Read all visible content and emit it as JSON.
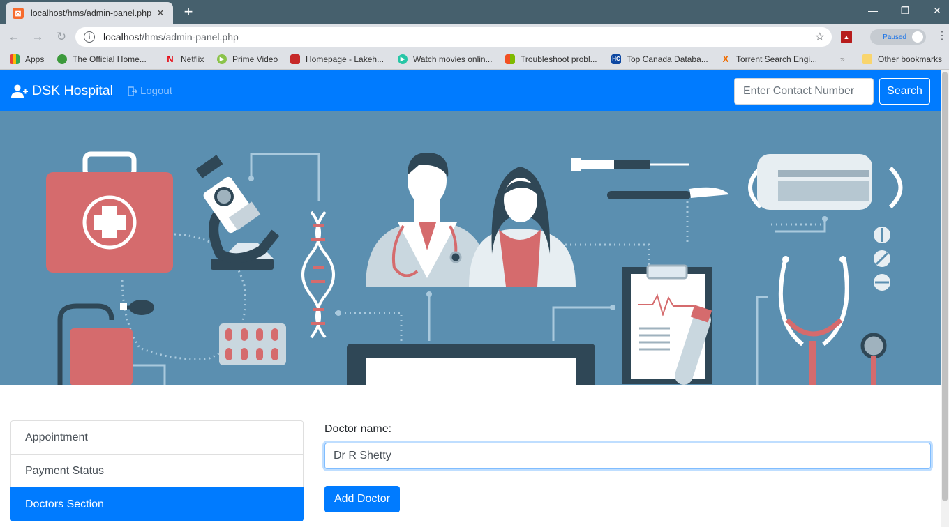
{
  "browser": {
    "tab_title": "localhost/hms/admin-panel.php",
    "url_host": "localhost",
    "url_path": "/hms/admin-panel.php",
    "profile_name": "Paused",
    "bookmarks": [
      {
        "label": "Apps",
        "icon": "apps-grid-icon",
        "color": "#4285f4"
      },
      {
        "label": "The Official Home...",
        "icon": "globe-icon",
        "color": "#3c9a3c"
      },
      {
        "label": "Netflix",
        "icon": "netflix-icon",
        "color": "#e50914"
      },
      {
        "label": "Prime Video",
        "icon": "play-icon",
        "color": "#8bc34a"
      },
      {
        "label": "Homepage - Lakeh...",
        "icon": "lakehead-icon",
        "color": "#c62828"
      },
      {
        "label": "Watch movies onlin...",
        "icon": "play-circle-icon",
        "color": "#26c6a6"
      },
      {
        "label": "Troubleshoot probl...",
        "icon": "windows-icon",
        "color": "#f25022"
      },
      {
        "label": "Top Canada Databa...",
        "icon": "hc-icon",
        "color": "#0d47a1"
      },
      {
        "label": "Torrent Search Engi...",
        "icon": "x-icon",
        "color": "#ef6c00"
      }
    ],
    "other_bookmarks": "Other bookmarks"
  },
  "navbar": {
    "brand": "DSK Hospital",
    "logout": "Logout",
    "search_placeholder": "Enter Contact Number",
    "search_button": "Search",
    "color": "#007bff"
  },
  "sidebar": {
    "items": [
      {
        "label": "Appointment",
        "active": false
      },
      {
        "label": "Payment Status",
        "active": false
      },
      {
        "label": "Doctors Section",
        "active": true
      }
    ]
  },
  "form": {
    "label": "Doctor name:",
    "value": "Dr R Shetty",
    "button": "Add Doctor"
  }
}
